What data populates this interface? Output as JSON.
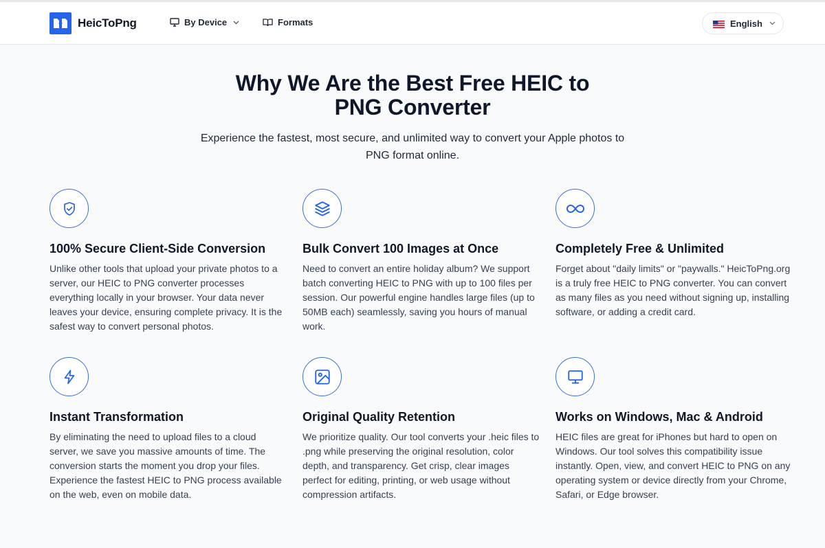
{
  "header": {
    "brand": "HeicToPng",
    "nav": {
      "by_device": "By Device",
      "formats": "Formats"
    },
    "language": "English"
  },
  "hero": {
    "title_line1": "Why We Are the Best Free HEIC to",
    "title_line2": "PNG Converter",
    "subtitle_line1": "Experience the fastest, most secure, and unlimited way to convert your Apple photos to",
    "subtitle_line2": "PNG format online."
  },
  "features": [
    {
      "icon": "shield-check-icon",
      "title": "100% Secure Client-Side Conversion",
      "body": "Unlike other tools that upload your private photos to a server, our HEIC to PNG converter processes everything locally in your browser. Your data never leaves your device, ensuring complete privacy. It is the safest way to convert personal photos."
    },
    {
      "icon": "layers-icon",
      "title": "Bulk Convert 100 Images at Once",
      "body": "Need to convert an entire holiday album? We support batch converting HEIC to PNG with up to 100 files per session. Our powerful engine handles large files (up to 50MB each) seamlessly, saving you hours of manual work."
    },
    {
      "icon": "infinity-icon",
      "title": "Completely Free & Unlimited",
      "body": "Forget about \"daily limits\" or \"paywalls.\" HeicToPng.org is a truly free HEIC to PNG converter. You can convert as many files as you need without signing up, installing software, or adding a credit card."
    },
    {
      "icon": "lightning-icon",
      "title": "Instant Transformation",
      "body": "By eliminating the need to upload files to a cloud server, we save you massive amounts of time. The conversion starts the moment you drop your files. Experience the fastest HEIC to PNG process available on the web, even on mobile data."
    },
    {
      "icon": "image-icon",
      "title": "Original Quality Retention",
      "body": "We prioritize quality. Our tool converts your .heic files to .png while preserving the original resolution, color depth, and transparency. Get crisp, clear images perfect for editing, printing, or web usage without compression artifacts."
    },
    {
      "icon": "monitor-icon",
      "title": "Works on Windows, Mac & Android",
      "body": "HEIC files are great for iPhones but hard to open on Windows. Our tool solves this compatibility issue instantly. Open, view, and convert HEIC to PNG on any operating system or device directly from your Chrome, Safari, or Edge browser."
    }
  ],
  "colors": {
    "accent": "#2563eb",
    "icon_stroke": "#3b6fd9",
    "background": "#f8fafc"
  }
}
